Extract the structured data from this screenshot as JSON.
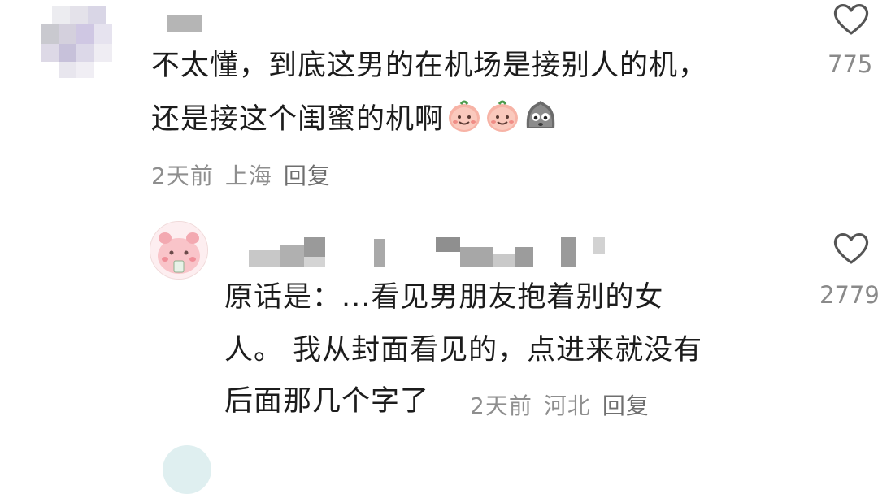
{
  "comments": [
    {
      "text_line1": "不太懂，到底这男的在机场是接别人的机，",
      "text_line2": "还是接这个闺蜜的机啊",
      "emojis": [
        "peach-smile-icon",
        "peach-smile-icon",
        "grey-blob-sad-icon"
      ],
      "time": "2天前",
      "location": "上海",
      "reply_label": "回复",
      "likes": "775"
    },
    {
      "text_line1": "原话是：...看见男朋友抱着别的女",
      "text_line2": "人。 我从封面看见的，点进来就没有",
      "text_line3": "后面那几个字了",
      "time": "2天前",
      "location": "河北",
      "reply_label": "回复",
      "likes": "2779"
    }
  ],
  "colors": {
    "text": "#1c1c1c",
    "meta": "#8e8e8e",
    "icon": "#555555"
  }
}
